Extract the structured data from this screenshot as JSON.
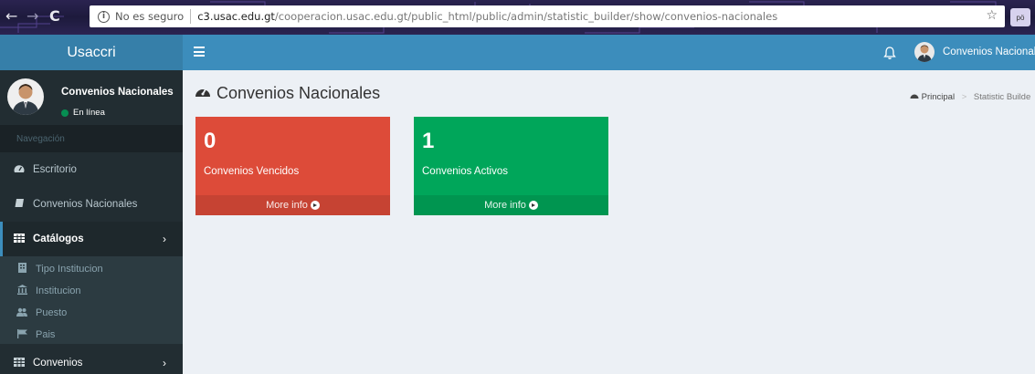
{
  "browser": {
    "back": "←",
    "forward": "→",
    "reload": "C",
    "security_label": "No es seguro",
    "url_host": "c3.usac.edu.gt",
    "url_path": "/cooperacion.usac.edu.gt/public_html/public/admin/statistic_builder/show/convenios-nacionales",
    "extension_label": "pö"
  },
  "header": {
    "logo": "Usaccri",
    "user_name": "Convenios Nacionales"
  },
  "sidebar": {
    "user_name": "Convenios Nacionales",
    "status": "En línea",
    "nav_header": "Navegación",
    "items": [
      {
        "label": "Escritorio",
        "icon": "dashboard-icon"
      },
      {
        "label": "Convenios Nacionales",
        "icon": "book-icon"
      },
      {
        "label": "Catálogos",
        "icon": "table-icon"
      },
      {
        "label": "Convenios",
        "icon": "table-icon"
      }
    ],
    "subitems": [
      {
        "label": "Tipo Institucion",
        "icon": "building-icon"
      },
      {
        "label": "Institucion",
        "icon": "institution-icon"
      },
      {
        "label": "Puesto",
        "icon": "users-icon"
      },
      {
        "label": "Pais",
        "icon": "flag-icon"
      }
    ]
  },
  "content": {
    "title": "Convenios Nacionales",
    "breadcrumb": {
      "home": "Principal",
      "current": "Statistic Builde"
    },
    "boxes": [
      {
        "value": "0",
        "label": "Convenios Vencidos",
        "footer": "More info",
        "color": "#dd4b39"
      },
      {
        "value": "1",
        "label": "Convenios Activos",
        "footer": "More info",
        "color": "#00a65a"
      }
    ]
  }
}
